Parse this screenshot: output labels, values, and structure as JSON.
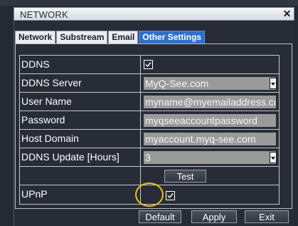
{
  "window": {
    "title": "NETWORK",
    "close_symbol": "✕"
  },
  "tabs": [
    {
      "label": "Network",
      "active": false
    },
    {
      "label": "Substream",
      "active": false
    },
    {
      "label": "Email",
      "active": false
    },
    {
      "label": "Other Settings",
      "active": true
    }
  ],
  "rows": {
    "ddns": {
      "label": "DDNS",
      "checked": true
    },
    "ddns_server": {
      "label": "DDNS Server",
      "value": "MyQ-See.com"
    },
    "user_name": {
      "label": "User Name",
      "value": "myname@myemailaddress.com"
    },
    "password": {
      "label": "Password",
      "value": "myqseeaccountpassword"
    },
    "host_domain": {
      "label": "Host Domain",
      "value": "myaccount.myq-see.com"
    },
    "ddns_update": {
      "label": "DDNS Update [Hours]",
      "value": "3"
    },
    "test": {
      "button_label": "Test"
    },
    "upnp": {
      "label": "UPnP",
      "checked": true
    }
  },
  "footer": {
    "default_label": "Default",
    "apply_label": "Apply",
    "exit_label": "Exit"
  },
  "colors": {
    "active_tab": "#2f6fcc",
    "highlight": "#f2c31a",
    "field_bg": "#9a9a9a"
  }
}
